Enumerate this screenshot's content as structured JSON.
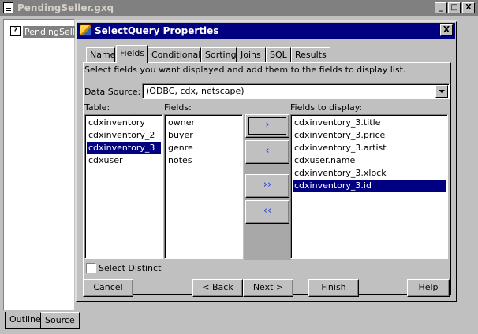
{
  "outer_window": {
    "title": "PendingSeller.gxq",
    "controls": [
      "_",
      "□",
      "X"
    ]
  },
  "outline_tree": {
    "item_icon": "?",
    "item_label": "PendingSeller"
  },
  "bottom_tabs": [
    "Outline",
    "Source"
  ],
  "dialog": {
    "title": "SelectQuery Properties",
    "close_label": "X",
    "tabs": [
      "Name",
      "Fields",
      "Conditionals",
      "Sorting",
      "Joins",
      "SQL",
      "Results"
    ],
    "active_tab": "Fields",
    "instructions": "Select fields you want displayed and add them to the fields to display list.",
    "data_source_label": "Data Source:",
    "data_source_value": "(ODBC, cdx, netscape)",
    "table_label": "Table:",
    "tables": [
      "cdxinventory",
      "cdxinventory_2",
      "cdxinventory_3",
      "cdxuser"
    ],
    "selected_table": "cdxinventory_3",
    "fields_label": "Fields:",
    "fields": [
      "owner",
      "buyer",
      "genre",
      "notes"
    ],
    "display_label": "Fields to display:",
    "display_fields": [
      "cdxinventory_3.title",
      "cdxinventory_3.price",
      "cdxinventory_3.artist",
      "cdxuser.name",
      "cdxinventory_3.xlock",
      "cdxinventory_3.id"
    ],
    "selected_display_field": "cdxinventory_3.id",
    "move_buttons": {
      "add_one": "›",
      "remove_one": "‹",
      "add_all": "››",
      "remove_all": "‹‹"
    },
    "select_distinct_label": "Select Distinct",
    "select_distinct_checked": false,
    "buttons": {
      "cancel": "Cancel",
      "back": "< Back",
      "next": "Next >",
      "finish": "Finish",
      "help": "Help"
    }
  }
}
